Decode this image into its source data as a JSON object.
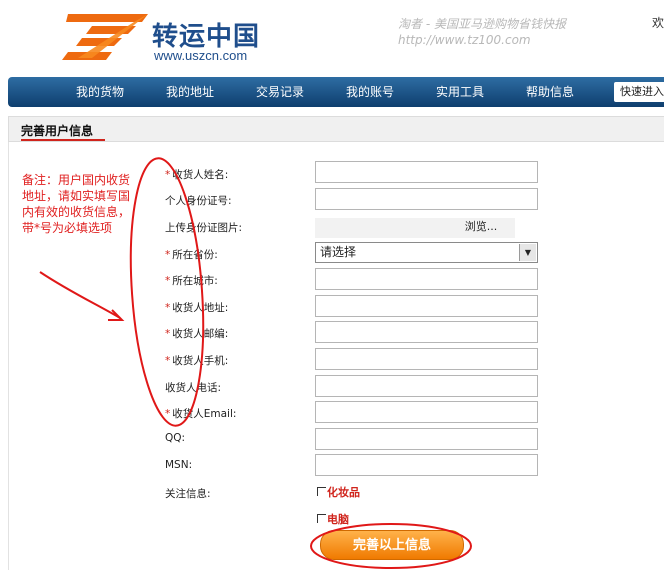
{
  "header": {
    "logo_text": "转运中国",
    "logo_url": "www.uszcn.com",
    "tagline_line1": "淘者 - 美国亚马逊购物省钱快报",
    "tagline_line2": "http://www.tz100.com",
    "top_right_char": "欢"
  },
  "nav": {
    "items": [
      "我的货物",
      "我的地址",
      "交易记录",
      "我的账号",
      "实用工具",
      "帮助信息"
    ],
    "quick": "快速进入"
  },
  "section": {
    "title": "完善用户信息"
  },
  "annotation": {
    "text": "备注：用户国内收货地址，请如实填写国内有效的收货信息，带*号为必填选项"
  },
  "form": {
    "required_mark": "*",
    "name_label": "收货人姓名:",
    "id_label": "个人身份证号:",
    "id_photo_label": "上传身份证图片:",
    "browse_label": "浏览...",
    "province_label": "所在省份:",
    "province_value": "请选择",
    "city_label": "所在城市:",
    "address_label": "收货人地址:",
    "zip_label": "收货人邮编:",
    "mobile_label": "收货人手机:",
    "phone_label": "收货人电话:",
    "email_label": "收货人Email:",
    "qq_label": "QQ:",
    "msn_label": "MSN:",
    "interest_label": "关注信息:",
    "interest_options": [
      "化妆品",
      "电脑"
    ],
    "submit_label": "完善以上信息"
  },
  "colors": {
    "nav_blue": "#1a5186",
    "required_red": "#d0241c",
    "annotation_red": "#e02020",
    "button_orange": "#f08a10"
  }
}
